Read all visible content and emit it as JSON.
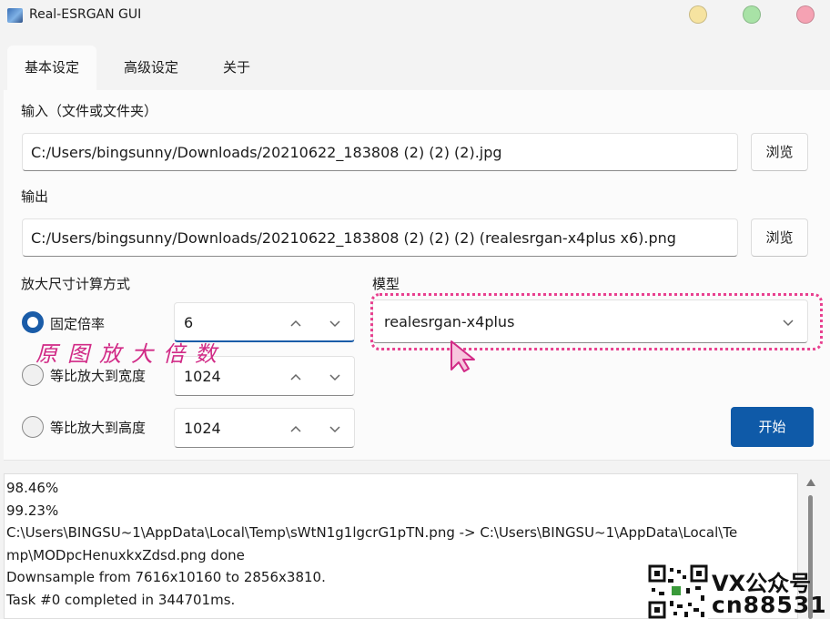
{
  "window": {
    "title": "Real-ESRGAN GUI"
  },
  "tabs": [
    {
      "label": "基本设定",
      "active": true
    },
    {
      "label": "高级设定",
      "active": false
    },
    {
      "label": "关于",
      "active": false
    }
  ],
  "input": {
    "label": "输入（文件或文件夹）",
    "value": "C:/Users/bingsunny/Downloads/20210622_183808 (2) (2) (2).jpg",
    "browse_label": "浏览"
  },
  "output": {
    "label": "输出",
    "value": "C:/Users/bingsunny/Downloads/20210622_183808 (2) (2) (2) (realesrgan-x4plus x6).png",
    "browse_label": "浏览"
  },
  "scale": {
    "section_label": "放大尺寸计算方式",
    "options": [
      {
        "label": "固定倍率",
        "value": "6",
        "checked": true
      },
      {
        "label": "等比放大到宽度",
        "value": "1024",
        "checked": false
      },
      {
        "label": "等比放大到高度",
        "value": "1024",
        "checked": false
      }
    ]
  },
  "model": {
    "section_label": "模型",
    "selected": "realesrgan-x4plus"
  },
  "start_label": "开始",
  "annotation": "原图放大倍数",
  "log_lines": [
    "98.46%",
    "99.23%",
    "C:\\Users\\BINGSU~1\\AppData\\Local\\Temp\\sWtN1g1lgcrG1pTN.png -> C:\\Users\\BINGSU~1\\AppData\\Local\\Te",
    "mp\\MODpcHenuxkxZdsd.png done",
    "Downsample from 7616x10160 to 2856x3810.",
    "Task #0 completed in 344701ms."
  ],
  "watermark": {
    "line1": "VX公众号",
    "line2": "cn88531"
  },
  "colors": {
    "accent": "#0f5aa8",
    "annotation": "#d12a86"
  }
}
